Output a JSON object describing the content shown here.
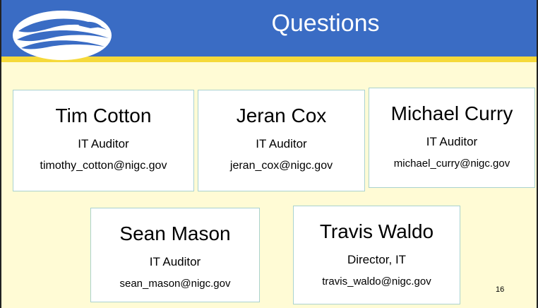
{
  "slide": {
    "title": "Questions",
    "page_number": "16"
  },
  "contacts": [
    {
      "name": "Tim Cotton",
      "role": "IT Auditor",
      "email": "timothy_cotton@nigc.gov"
    },
    {
      "name": "Jeran Cox",
      "role": "IT Auditor",
      "email": "jeran_cox@nigc.gov"
    },
    {
      "name": "Michael Curry",
      "role": "IT Auditor",
      "email": "michael_curry@nigc.gov"
    },
    {
      "name": "Sean Mason",
      "role": "IT Auditor",
      "email": "sean_mason@nigc.gov"
    },
    {
      "name": "Travis Waldo",
      "role": "Director, IT",
      "email": "travis_waldo@nigc.gov"
    }
  ],
  "colors": {
    "header": "#3a6cc4",
    "accent_stripe": "#f5d93a",
    "background": "#fffbd5",
    "card_border": "#a9d2cf"
  }
}
